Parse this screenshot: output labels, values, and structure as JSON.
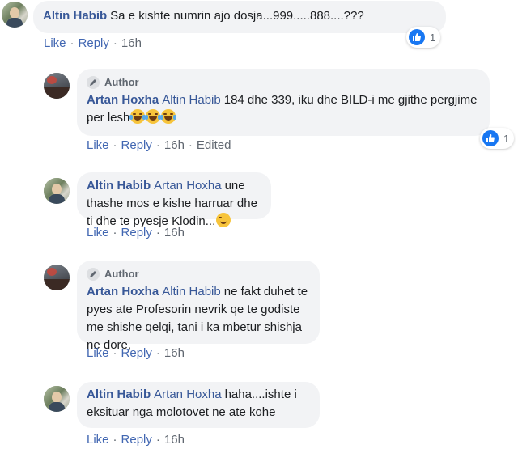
{
  "colors": {
    "link": "#385898",
    "meta": "#606770",
    "bubble": "#f2f3f5",
    "like": "#1877f2"
  },
  "comments": [
    {
      "name": "Altin Habib",
      "text": "Sa e kishte numrin ajo dosja...999.....888....???",
      "actions": {
        "like": "Like",
        "reply": "Reply",
        "time": "16h"
      },
      "reactions": {
        "count": "1"
      }
    },
    {
      "badge": "Author",
      "name": "Artan Hoxha",
      "tag": "Altin Habib",
      "text": "184 dhe 339, iku dhe BILD-i me gjithe pergjime per lesh",
      "emoji": [
        "laughing-tears-emoji",
        "laughing-tears-emoji",
        "laughing-tears-emoji"
      ],
      "actions": {
        "like": "Like",
        "reply": "Reply",
        "time": "16h",
        "edited": "Edited"
      },
      "reactions": {
        "count": "1"
      }
    },
    {
      "name": "Altin Habib",
      "tag": "Artan Hoxha",
      "text": "une thashe mos e kishe harruar dhe ti dhe te pyesje Klodin...",
      "emoji": [
        "wink-emoji"
      ],
      "actions": {
        "like": "Like",
        "reply": "Reply",
        "time": "16h"
      }
    },
    {
      "badge": "Author",
      "name": "Artan Hoxha",
      "tag": "Altin Habib",
      "text": "ne fakt duhet te pyes ate Profesorin nevrik qe te godiste me shishe qelqi, tani i ka mbetur shishja ne dore,",
      "actions": {
        "like": "Like",
        "reply": "Reply",
        "time": "16h"
      }
    },
    {
      "name": "Altin Habib",
      "tag": "Artan Hoxha",
      "text": "haha....ishte i eksituar nga molotovet ne ate kohe",
      "actions": {
        "like": "Like",
        "reply": "Reply",
        "time": "16h"
      }
    }
  ]
}
